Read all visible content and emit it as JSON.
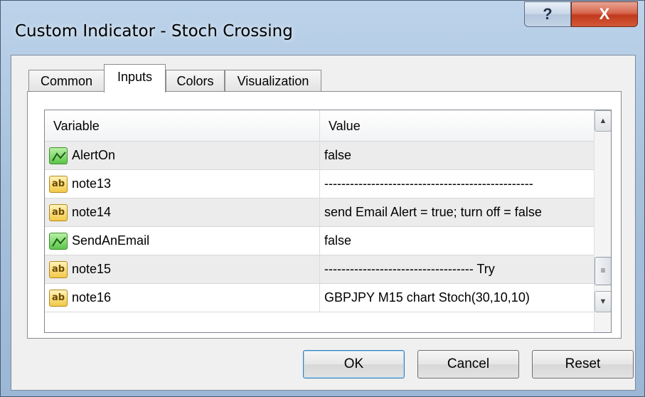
{
  "window": {
    "title": "Custom Indicator - Stoch Crossing",
    "help_label": "?",
    "close_label": "X"
  },
  "tabs": [
    {
      "label": "Common",
      "active": false
    },
    {
      "label": "Inputs",
      "active": true
    },
    {
      "label": "Colors",
      "active": false
    },
    {
      "label": "Visualization",
      "active": false
    }
  ],
  "grid": {
    "columns": [
      "Variable",
      "Value"
    ],
    "rows": [
      {
        "icon": "bool-icon",
        "name": "AlertOn",
        "value": "false"
      },
      {
        "icon": "string-icon",
        "icon_text": "ab",
        "name": "note13",
        "value": "-------------------------------------------------"
      },
      {
        "icon": "string-icon",
        "icon_text": "ab",
        "name": "note14",
        "value": "send Email Alert = true; turn off = false"
      },
      {
        "icon": "bool-icon",
        "name": "SendAnEmail",
        "value": "false"
      },
      {
        "icon": "string-icon",
        "icon_text": "ab",
        "name": "note15",
        "value": "----------------------------------- Try"
      },
      {
        "icon": "string-icon",
        "icon_text": "ab",
        "name": "note16",
        "value": "GBPJPY M15 chart Stoch(30,10,10)"
      }
    ]
  },
  "scrollbar": {
    "up_glyph": "▲",
    "down_glyph": "▼",
    "thumb_glyph": "≡"
  },
  "buttons": {
    "ok": "OK",
    "cancel": "Cancel",
    "reset": "Reset"
  },
  "colors": {
    "titlebar": "#a7c1dc",
    "close_button": "#c2391c",
    "bool_icon": "#5cc54a",
    "string_icon": "#f2c94a"
  }
}
